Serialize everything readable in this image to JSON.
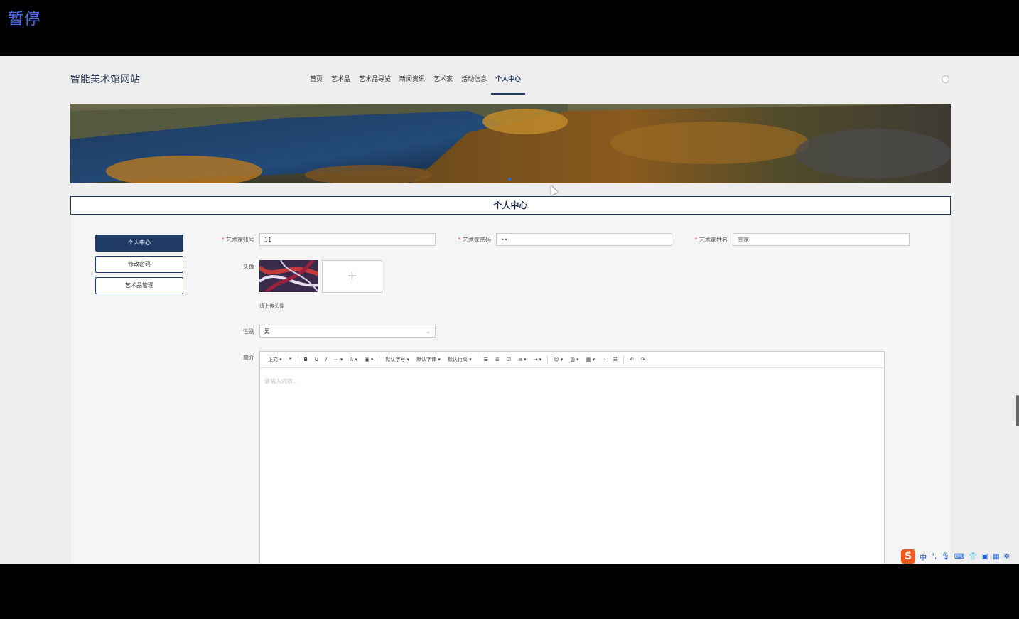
{
  "overlay": {
    "pause_label": "暂停"
  },
  "header": {
    "site_title": "智能美术馆网站",
    "nav": [
      "首页",
      "艺术品",
      "艺术品导览",
      "新闻资讯",
      "艺术家",
      "活动信息",
      "个人中心"
    ],
    "active_nav": "个人中心"
  },
  "page_title": "个人中心",
  "sidebar": {
    "items": [
      {
        "label": "个人中心",
        "active": true
      },
      {
        "label": "修改密码",
        "active": false
      },
      {
        "label": "艺术品管理",
        "active": false
      }
    ]
  },
  "form": {
    "account": {
      "label": "艺术家账号",
      "value": "11"
    },
    "password": {
      "label": "艺术家密码",
      "value": "••"
    },
    "name": {
      "label": "艺术家姓名",
      "value": "宣家"
    },
    "avatar": {
      "label": "头像",
      "hint": "请上传头像",
      "upload_icon": "+"
    },
    "gender": {
      "label": "性别",
      "value": "男"
    },
    "intro": {
      "label": "简介",
      "placeholder": "请输入内容..."
    }
  },
  "editor_toolbar": {
    "paragraph": "正文",
    "font_size": "默认字号",
    "font_family": "默认字体",
    "line_height": "默认行高",
    "icons": [
      "quote-icon",
      "bold-icon",
      "underline-icon",
      "italic-icon",
      "more-icon",
      "font-color-icon",
      "bg-color-icon",
      "bullet-list-icon",
      "ordered-list-icon",
      "todo-icon",
      "align-icon",
      "indent-icon",
      "emoji-icon",
      "image-icon",
      "table-icon",
      "code-icon",
      "divider-icon",
      "undo-icon",
      "redo-icon"
    ]
  },
  "ime": {
    "logo": "S",
    "mode": "中"
  },
  "colors": {
    "primary": "#1f3b63",
    "pause": "#4a6fe0"
  }
}
